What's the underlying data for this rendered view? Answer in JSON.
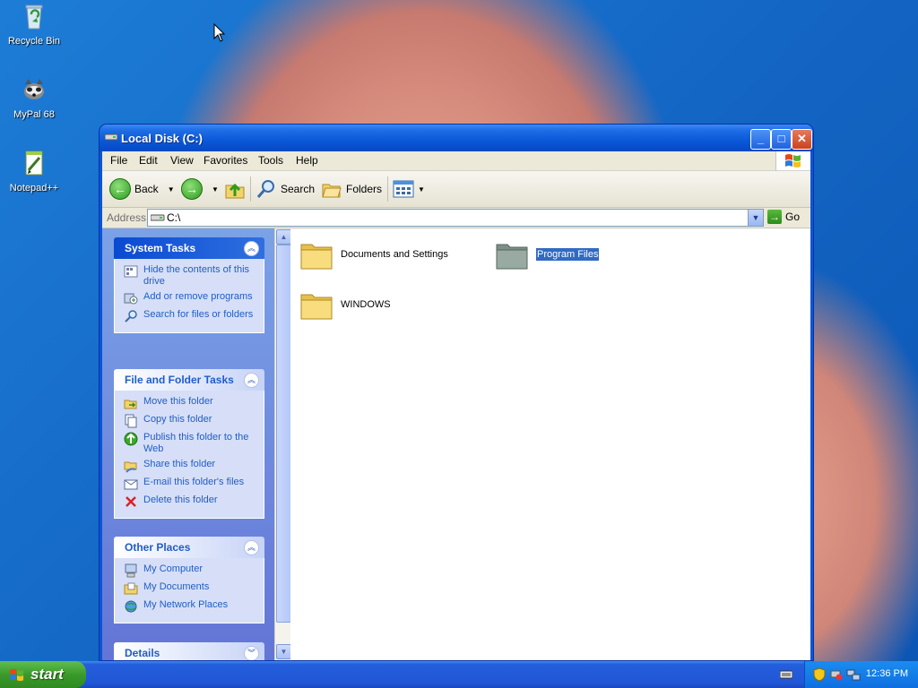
{
  "desktop": {
    "icons": [
      {
        "label": "Recycle Bin",
        "icon": "recycle-bin-icon"
      },
      {
        "label": "MyPal 68",
        "icon": "mypal-icon"
      },
      {
        "label": "Notepad++",
        "icon": "notepadpp-icon"
      }
    ]
  },
  "window": {
    "title": "Local Disk (C:)",
    "minimize": "_",
    "maximize": "□",
    "close": "✕"
  },
  "menu": [
    "File",
    "Edit",
    "View",
    "Favorites",
    "Tools",
    "Help"
  ],
  "toolbar": {
    "back": "Back",
    "search": "Search",
    "folders": "Folders"
  },
  "address": {
    "label": "Address",
    "value": "C:\\",
    "go": "Go"
  },
  "panels": {
    "system_tasks": {
      "title": "System Tasks",
      "items": [
        "Hide the contents of this drive",
        "Add or remove programs",
        "Search for files or folders"
      ]
    },
    "file_folder_tasks": {
      "title": "File and Folder Tasks",
      "items": [
        "Move this folder",
        "Copy this folder",
        "Publish this folder to the Web",
        "Share this folder",
        "E-mail this folder's files",
        "Delete this folder"
      ]
    },
    "other_places": {
      "title": "Other Places",
      "items": [
        "My Computer",
        "My Documents",
        "My Network Places"
      ]
    },
    "details": {
      "title": "Details"
    }
  },
  "files": [
    {
      "name": "Documents and Settings",
      "selected": false
    },
    {
      "name": "Program Files",
      "selected": true
    },
    {
      "name": "WINDOWS",
      "selected": false
    }
  ],
  "taskbar": {
    "start": "start",
    "clock": "12:36 PM"
  },
  "colors": {
    "accent": "#0a56d6",
    "link": "#215dc6",
    "selection": "#316ac5"
  }
}
